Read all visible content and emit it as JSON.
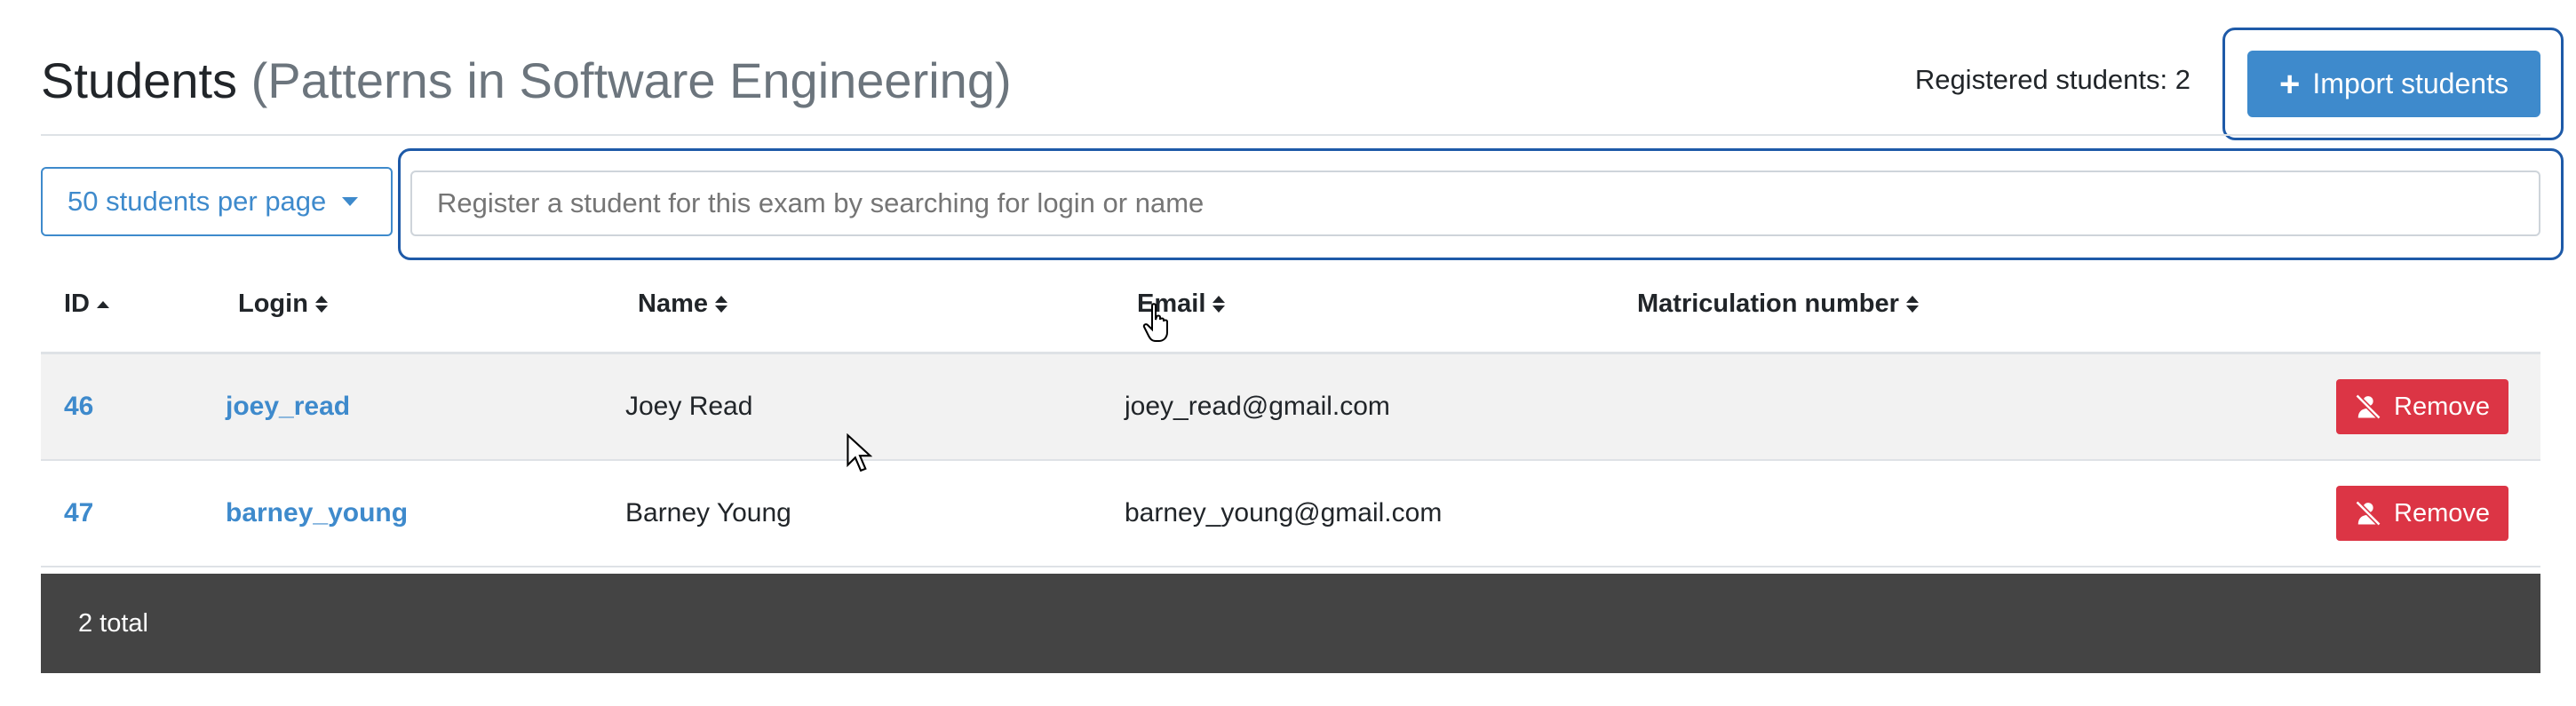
{
  "header": {
    "title": "Students",
    "subtitle": "(Patterns in Software Engineering)",
    "registered_label": "Registered students: 2",
    "import_button": "Import students"
  },
  "controls": {
    "per_page": "50 students per page",
    "search_placeholder": "Register a student for this exam by searching for login or name"
  },
  "table": {
    "columns": [
      "ID",
      "Login",
      "Name",
      "Email",
      "Matriculation number"
    ],
    "rows": [
      {
        "id": "46",
        "login": "joey_read",
        "name": "Joey Read",
        "email": "joey_read@gmail.com",
        "matriculation": "",
        "action": "Remove"
      },
      {
        "id": "47",
        "login": "barney_young",
        "name": "Barney Young",
        "email": "barney_young@gmail.com",
        "matriculation": "",
        "action": "Remove"
      }
    ],
    "footer": "2 total"
  },
  "colors": {
    "primary": "#3e8acc",
    "danger": "#dc3545",
    "footer_bg": "#444444",
    "highlight": "#1e5aa8"
  }
}
